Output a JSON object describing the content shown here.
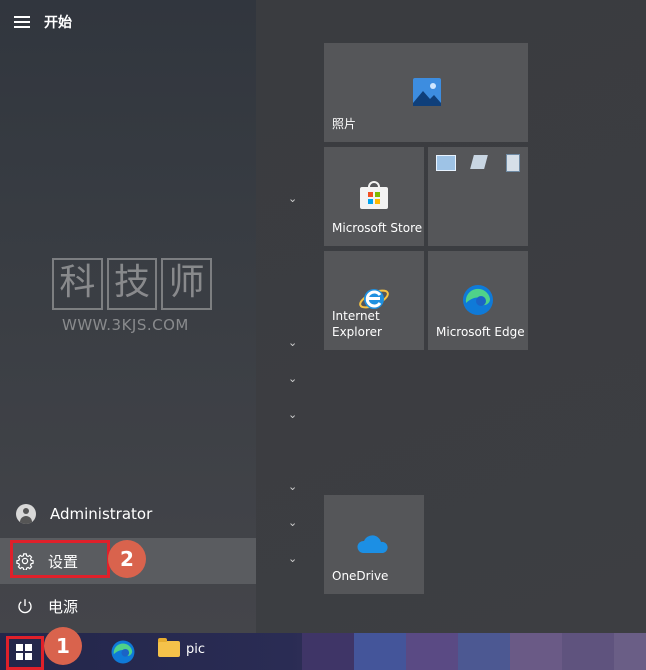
{
  "start_menu": {
    "title": "开始",
    "watermark": {
      "chars": [
        "科",
        "技",
        "师"
      ],
      "url": "WWW.3KJS.COM"
    },
    "user": "Administrator",
    "settings_label": "设置",
    "power_label": "电源"
  },
  "tiles": {
    "photos": "照片",
    "store": "Microsoft Store",
    "ie_line1": "Internet",
    "ie_line2": "Explorer",
    "edge": "Microsoft Edge",
    "onedrive": "OneDrive"
  },
  "taskbar": {
    "pic_label": "pic"
  },
  "annotations": {
    "step1": "1",
    "step2": "2"
  },
  "colors": {
    "highlight_red": "#e0202a",
    "badge": "#d9634d"
  }
}
